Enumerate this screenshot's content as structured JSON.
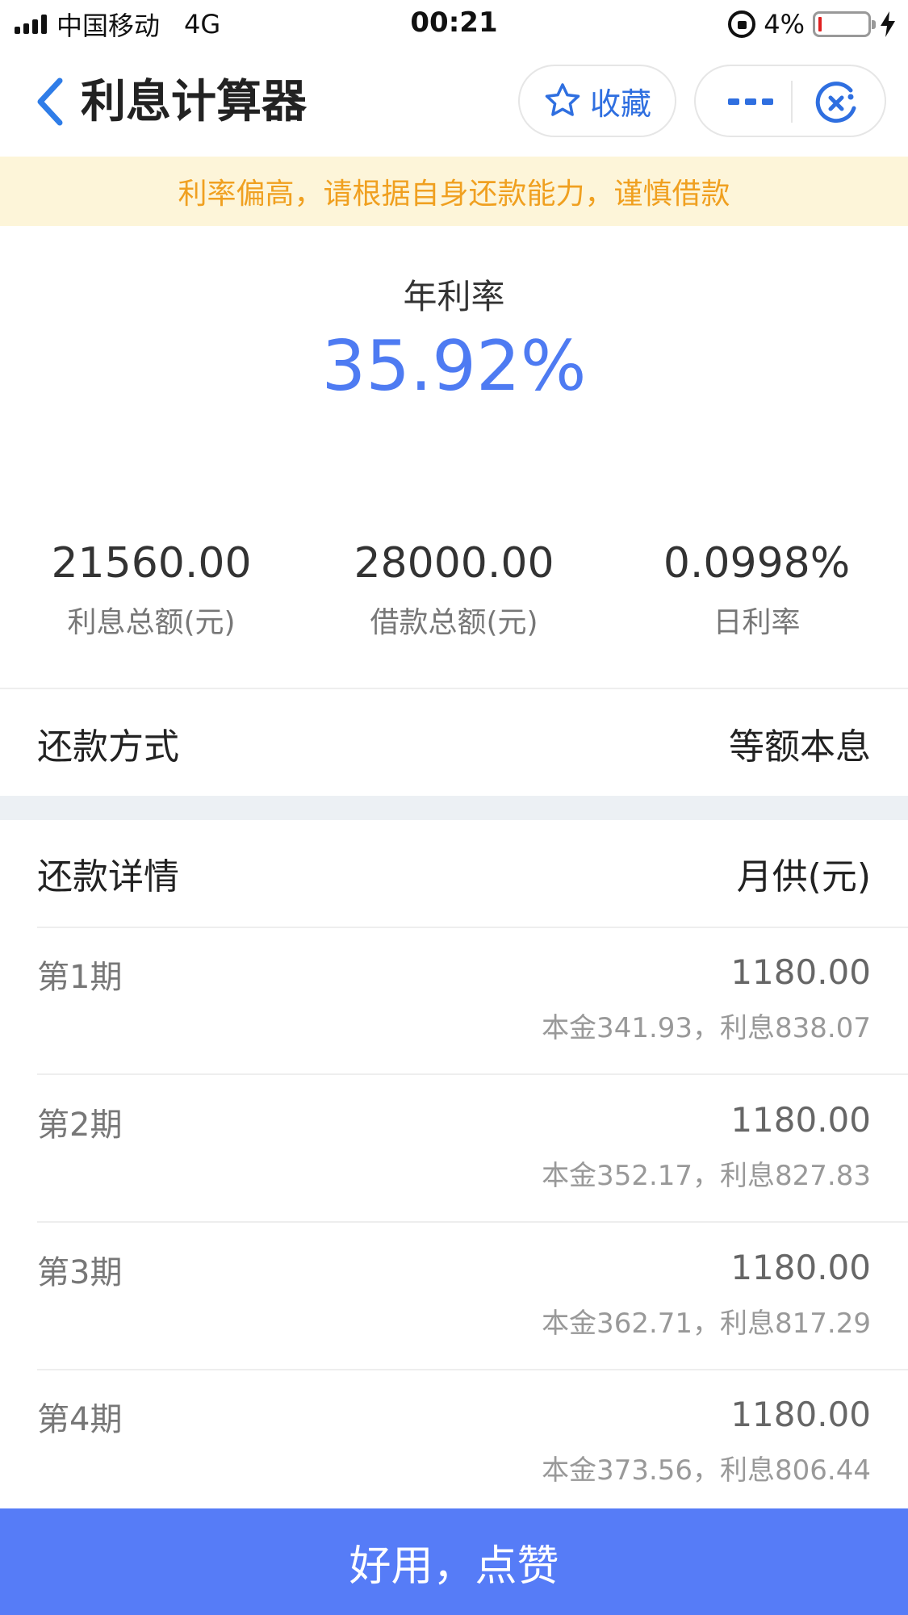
{
  "status_bar": {
    "carrier": "中国移动",
    "network": "4G",
    "time": "00:21",
    "battery": "4%"
  },
  "nav": {
    "title": "利息计算器",
    "favorite_label": "收藏"
  },
  "warning": "利率偏高，请根据自身还款能力，谨慎借款",
  "rate": {
    "label": "年利率",
    "value": "35.92%"
  },
  "stats": [
    {
      "value": "21560.00",
      "label": "利息总额(元)"
    },
    {
      "value": "28000.00",
      "label": "借款总额(元)"
    },
    {
      "value": "0.0998%",
      "label": "日利率"
    }
  ],
  "repayment_method": {
    "label": "还款方式",
    "value": "等额本息"
  },
  "details_header": {
    "label": "还款详情",
    "value": "月供(元)"
  },
  "periods": [
    {
      "name": "第1期",
      "amount": "1180.00",
      "detail": "本金341.93，利息838.07"
    },
    {
      "name": "第2期",
      "amount": "1180.00",
      "detail": "本金352.17，利息827.83"
    },
    {
      "name": "第3期",
      "amount": "1180.00",
      "detail": "本金362.71，利息817.29"
    },
    {
      "name": "第4期",
      "amount": "1180.00",
      "detail": "本金373.56，利息806.44"
    }
  ],
  "like_button": "好用，点赞",
  "colors": {
    "accent": "#4e7bf2",
    "button": "#567cf7",
    "warning_bg": "#fdf5d9",
    "warning_text": "#f0a020"
  }
}
